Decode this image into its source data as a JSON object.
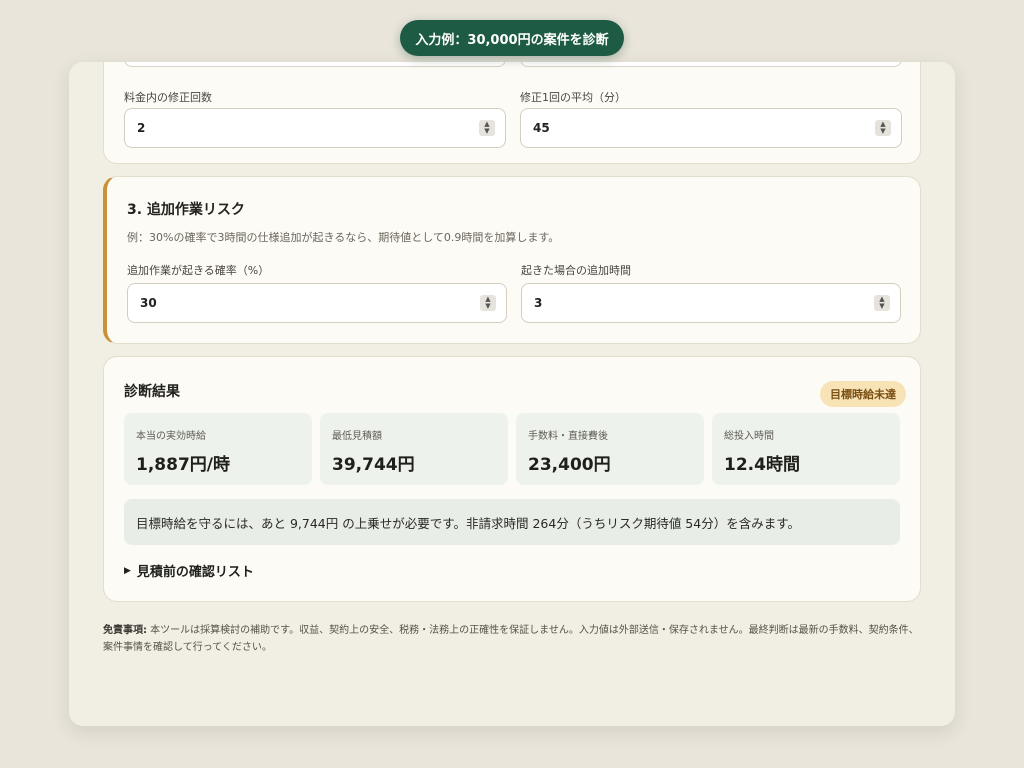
{
  "example_button": "入力例：30,000円の案件を診断",
  "revisions": {
    "count_label": "料金内の修正回数",
    "count_value": "2",
    "avg_label": "修正1回の平均（分）",
    "avg_value": "45"
  },
  "risk": {
    "title": "3. 追加作業リスク",
    "description": "例：30%の確率で3時間の仕様追加が起きるなら、期待値として0.9時間を加算します。",
    "prob_label": "追加作業が起きる確率（%）",
    "prob_value": "30",
    "hours_label": "起きた場合の追加時間",
    "hours_value": "3"
  },
  "result": {
    "title": "診断結果",
    "badge": "目標時給未達",
    "stats": [
      {
        "label": "本当の実効時給",
        "value": "1,887円/時"
      },
      {
        "label": "最低見積額",
        "value": "39,744円"
      },
      {
        "label": "手数料・直接費後",
        "value": "23,400円"
      },
      {
        "label": "総投入時間",
        "value": "12.4時間"
      }
    ],
    "summary": "目標時給を守るには、あと 9,744円 の上乗せが必要です。非請求時間 264分（うちリスク期待値 54分）を含みます。",
    "checklist_toggle": "見積前の確認リスト"
  },
  "disclaimer": {
    "label": "免責事項:",
    "text": " 本ツールは採算検討の補助です。収益、契約上の安全、税務・法務上の正確性を保証しません。入力値は外部送信・保存されません。最終判断は最新の手数料、契約条件、案件事情を確認して行ってください。"
  },
  "colors": {
    "accent": "#1e5b44",
    "risk_border": "#c8913a",
    "badge_bg": "#f7e3b6"
  }
}
